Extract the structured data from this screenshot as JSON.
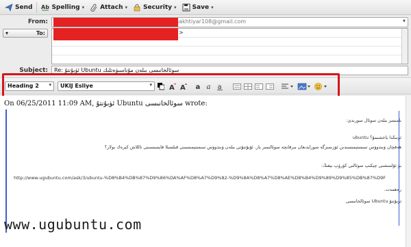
{
  "toolbar": {
    "send_label": "Send",
    "spelling_label": "Spelling",
    "attach_label": "Attach",
    "security_label": "Security",
    "save_label": "Save",
    "dropdown_glyph": "▾",
    "icons": [
      "send-icon",
      "spelling-icon",
      "paperclip-icon",
      "lock-icon",
      "floppy-icon"
    ]
  },
  "header": {
    "from_label": "From:",
    "from_value": "hakhtiyar108@gmail.com",
    "to_type": "To:",
    "to_value": ">",
    "subject_label": "Subject:",
    "subject_value": "Re: ئۈبۇنتۇ Ubuntu سوئالخانىسى بىلەن مۇناسىۋەتلىك"
  },
  "format_bar": {
    "paragraph_style": "Heading 2",
    "font_name": "UKIJ Esliye",
    "dropdown_glyph": "▾",
    "icons": [
      "text-color-icon",
      "shrink-font-icon",
      "grow-font-icon",
      "bold-icon",
      "italic-icon",
      "underline-icon",
      "bullet-list-icon",
      "numbered-list-icon",
      "outdent-icon",
      "indent-icon",
      "align-icon",
      "insert-image-icon",
      "emoticon-icon"
    ]
  },
  "message": {
    "wrote_line": "On 06/25/2011 11:09 AM, ئۈبۇنتۇ Ubuntu سوئالخانىسى wrote:",
    "quote_lines": [
      "نامىسز بىلەن سوئال سورىدى:",
      "ئۈنىڭدا ياخشىمۇ؟ ubuntu",
      "ھەقچان ۋىندوۋس سىستېمىسىدىن ئۆزىمىزگە سورايدىغان بىرقانچە سوئالىمىز بار. ئۇبۇنتۇنى بىلەن ۋىندوۋس سىستېمىسىنى قىلسىلا قايسىسىنى تاللاش كېرەك بولار؟",
      "بۇ ئۇلىنىشنى چېكىپ سوئالنى كۆرۈپ بېقىڭ:",
      "http://www.ugubuntu.com/ask/3/ubuntu-%D8%B4%DB%87%D9%86%DA%AF%D8%A7%D9%82-%D9%8A%D8%A7%D8%AE%D8%B4%D9%89%D9%85%DB%87%D9F",
      "رەھمەت.",
      "ئۈبۇنتۇ Ubuntu سوئالخانىسى"
    ],
    "watermark": "www.ugubuntu.com"
  },
  "colors": {
    "highlight": "#d4141c",
    "redaction": "#e52222",
    "quote_rule": "#3a5fcd"
  }
}
